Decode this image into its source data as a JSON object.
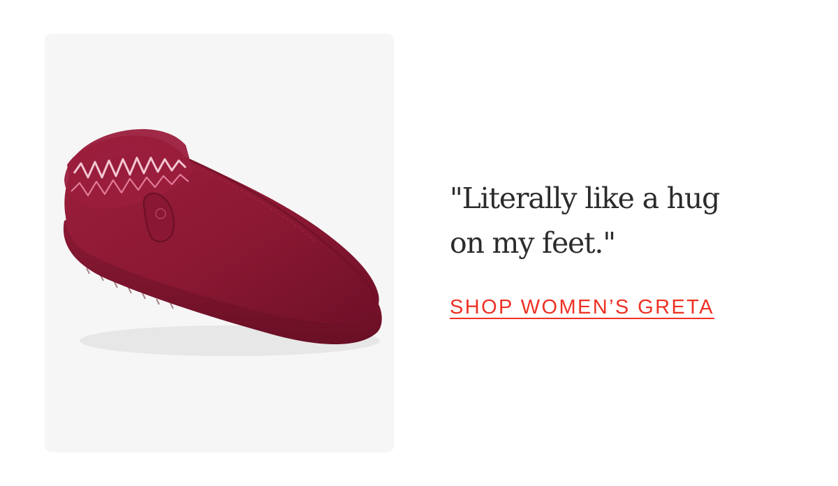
{
  "product": {
    "image_alt": "Burgundy suede slipper with fleece lining and zigzag stitched collar"
  },
  "testimonial": {
    "line1": "\"Literally like a hug",
    "line2": "on my feet.\""
  },
  "cta": {
    "label": "SHOP WOMEN’S GRETA"
  },
  "colors": {
    "accent": "#ee3124",
    "text": "#2b2b2b",
    "card_bg": "#f6f6f6",
    "slipper": "#8e1a35"
  }
}
